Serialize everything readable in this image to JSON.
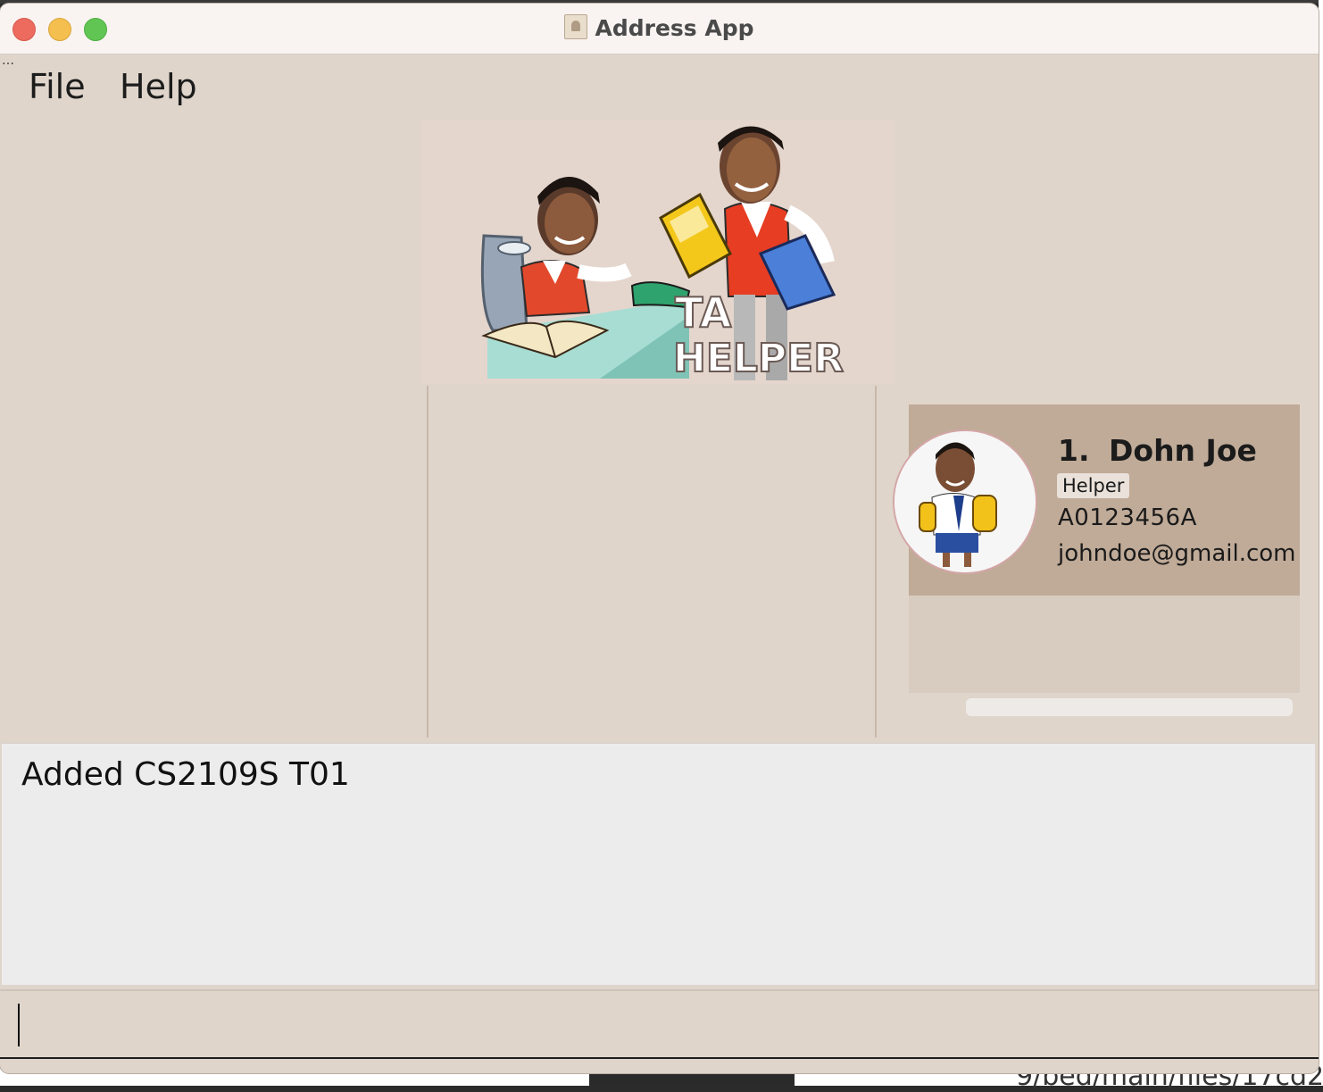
{
  "window": {
    "title": "Address App"
  },
  "menubar": {
    "items": [
      {
        "label": "File"
      },
      {
        "label": "Help"
      }
    ]
  },
  "banner": {
    "text_line1": "TA",
    "text_line2": "HELPER"
  },
  "person_list": {
    "persons": [
      {
        "index": "1.",
        "name": "Dohn Joe",
        "tag": "Helper",
        "student_id": "A0123456A",
        "email": "johndoe@gmail.com"
      }
    ]
  },
  "result_display": {
    "message": "Added CS2109S T01"
  },
  "command_box": {
    "value": ""
  },
  "background": {
    "partial_text": "9/bed/main/files/17cd2"
  }
}
